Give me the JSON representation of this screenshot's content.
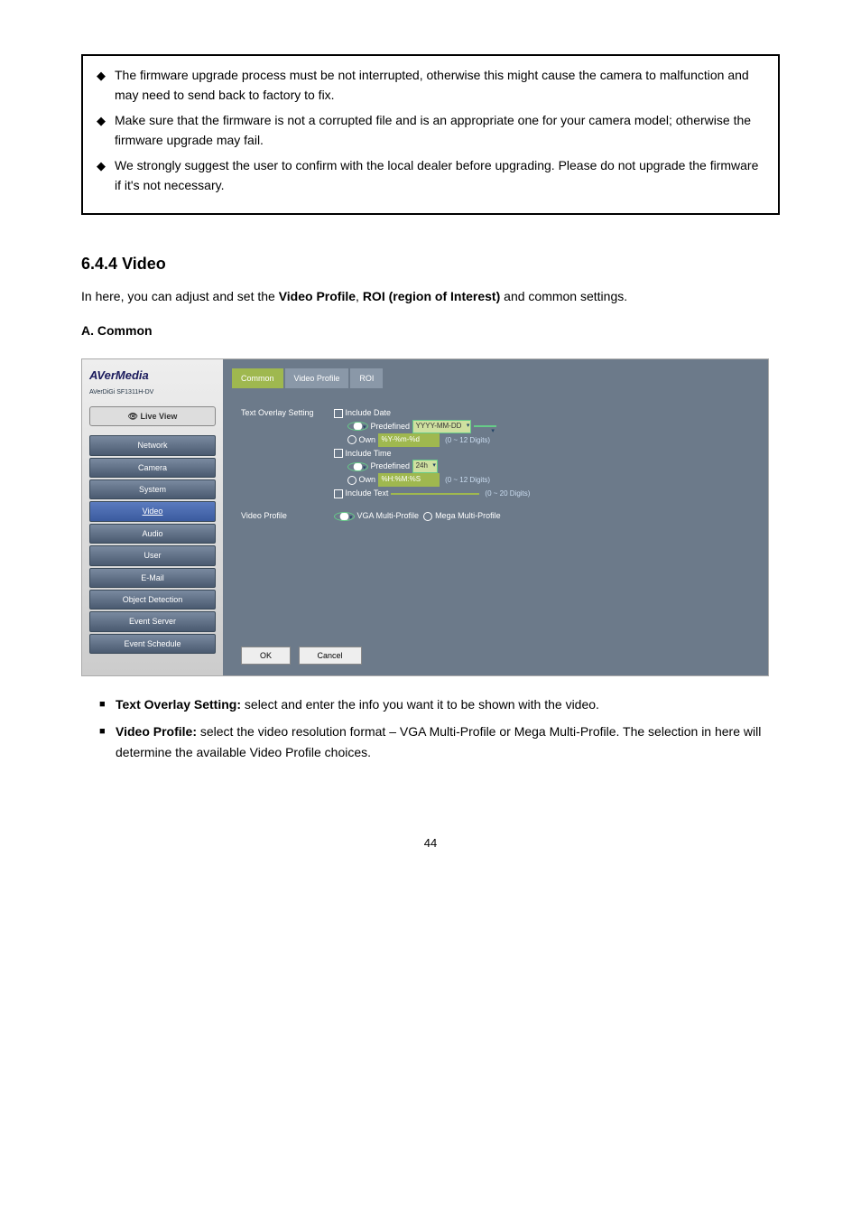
{
  "notices": [
    "The firmware upgrade process must be not interrupted, otherwise this might cause the camera to malfunction and may need to send back to factory to fix.",
    "Make sure that the firmware is not a corrupted file and is an appropriate one for your camera model; otherwise the firmware upgrade may fail.",
    "We strongly suggest the user to confirm with the local dealer before upgrading. Please do not upgrade the firmware if it's not necessary."
  ],
  "section": {
    "num": "6.4.4",
    "title": "Video"
  },
  "intro_a": "In here, you can adjust and set the ",
  "intro_b": "Video Profile",
  "intro_c": ", ",
  "intro_d": "ROI (region of Interest)",
  "intro_e": " and common settings.",
  "sub1": "A. Common",
  "screenshot": {
    "logo": "AVerMedia",
    "sublogo": "AVerDiGi SF1311H-DV",
    "liveview": "👁 Live View",
    "nav": [
      "Network",
      "Camera",
      "System",
      "Video",
      "Audio",
      "User",
      "E-Mail",
      "Object Detection",
      "Event Server",
      "Event Schedule"
    ],
    "nav_active": 3,
    "tabs": [
      "Common",
      "Video Profile",
      "ROI"
    ],
    "tab_active": 0,
    "form": {
      "label1": "Text Overlay Setting",
      "include_date": "Include Date",
      "predef": "Predefined",
      "date_val": "YYYY-MM-DD",
      "own": "Own",
      "own_date_val": "%Y-%m-%d",
      "digits12": "(0 ~ 12 Digits)",
      "include_time": "Include Time",
      "time_sel": "24h",
      "own_time_val": "%H:%M:%S",
      "include_text": "Include Text",
      "digits20": "(0 ~ 20 Digits)",
      "label2": "Video Profile",
      "vp_a": "VGA Multi-Profile",
      "vp_b": "Mega Multi-Profile"
    },
    "ok": "OK",
    "cancel": "Cancel"
  },
  "bullets": [
    {
      "b": "Text Overlay Setting:",
      "t": " select and enter the info you want it to be shown with the video."
    },
    {
      "b": "Video Profile:",
      "t": " select the video resolution format – VGA Multi-Profile or Mega Multi-Profile. The selection in here will determine the available Video Profile choices."
    }
  ],
  "page_num": "44"
}
